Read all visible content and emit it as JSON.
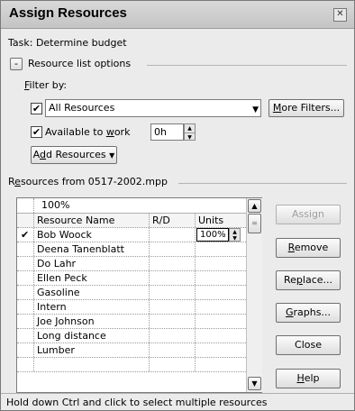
{
  "window": {
    "title": "Assign Resources",
    "close_glyph": "✕"
  },
  "task": {
    "text": "Task: Determine budget"
  },
  "options": {
    "toggle_glyph": "-",
    "group_label": "Resource list options"
  },
  "filter": {
    "label_pre": "",
    "label_u": "F",
    "label_post": "ilter by:",
    "value": "All Resources",
    "more_filters_pre": "",
    "more_filters_u": "M",
    "more_filters_post": "ore Filters..."
  },
  "available": {
    "label_pre": "Available to ",
    "label_u": "w",
    "label_post": "ork",
    "value": "0h"
  },
  "add_resources": {
    "pre": "A",
    "u": "d",
    "post": "d Resources"
  },
  "resources_group": {
    "pre": "R",
    "u": "e",
    "post": "sources from 0517-2002.mpp"
  },
  "grid": {
    "edit_value": "100%",
    "headers": [
      "Resource Name",
      "R/D",
      "Units"
    ],
    "rows": [
      {
        "check": "✔",
        "name": "Bob Woock",
        "rd": "",
        "units": "100%"
      },
      {
        "check": "",
        "name": "Deena Tanenblatt",
        "rd": "",
        "units": ""
      },
      {
        "check": "",
        "name": "Do Lahr",
        "rd": "",
        "units": ""
      },
      {
        "check": "",
        "name": "Ellen Peck",
        "rd": "",
        "units": ""
      },
      {
        "check": "",
        "name": "Gasoline",
        "rd": "",
        "units": ""
      },
      {
        "check": "",
        "name": "Intern",
        "rd": "",
        "units": ""
      },
      {
        "check": "",
        "name": "Joe Johnson",
        "rd": "",
        "units": ""
      },
      {
        "check": "",
        "name": "Long distance",
        "rd": "",
        "units": ""
      },
      {
        "check": "",
        "name": "Lumber",
        "rd": "",
        "units": ""
      },
      {
        "check": "",
        "name": "",
        "rd": "",
        "units": ""
      }
    ]
  },
  "buttons": {
    "assign": "Assign",
    "remove_u": "R",
    "remove_post": "emove",
    "replace_pre": "Re",
    "replace_u": "p",
    "replace_post": "lace...",
    "graphs_u": "G",
    "graphs_post": "raphs...",
    "close": "Close",
    "help_u": "H",
    "help_post": "elp"
  },
  "status": {
    "text": "Hold down Ctrl and click to select multiple resources"
  }
}
